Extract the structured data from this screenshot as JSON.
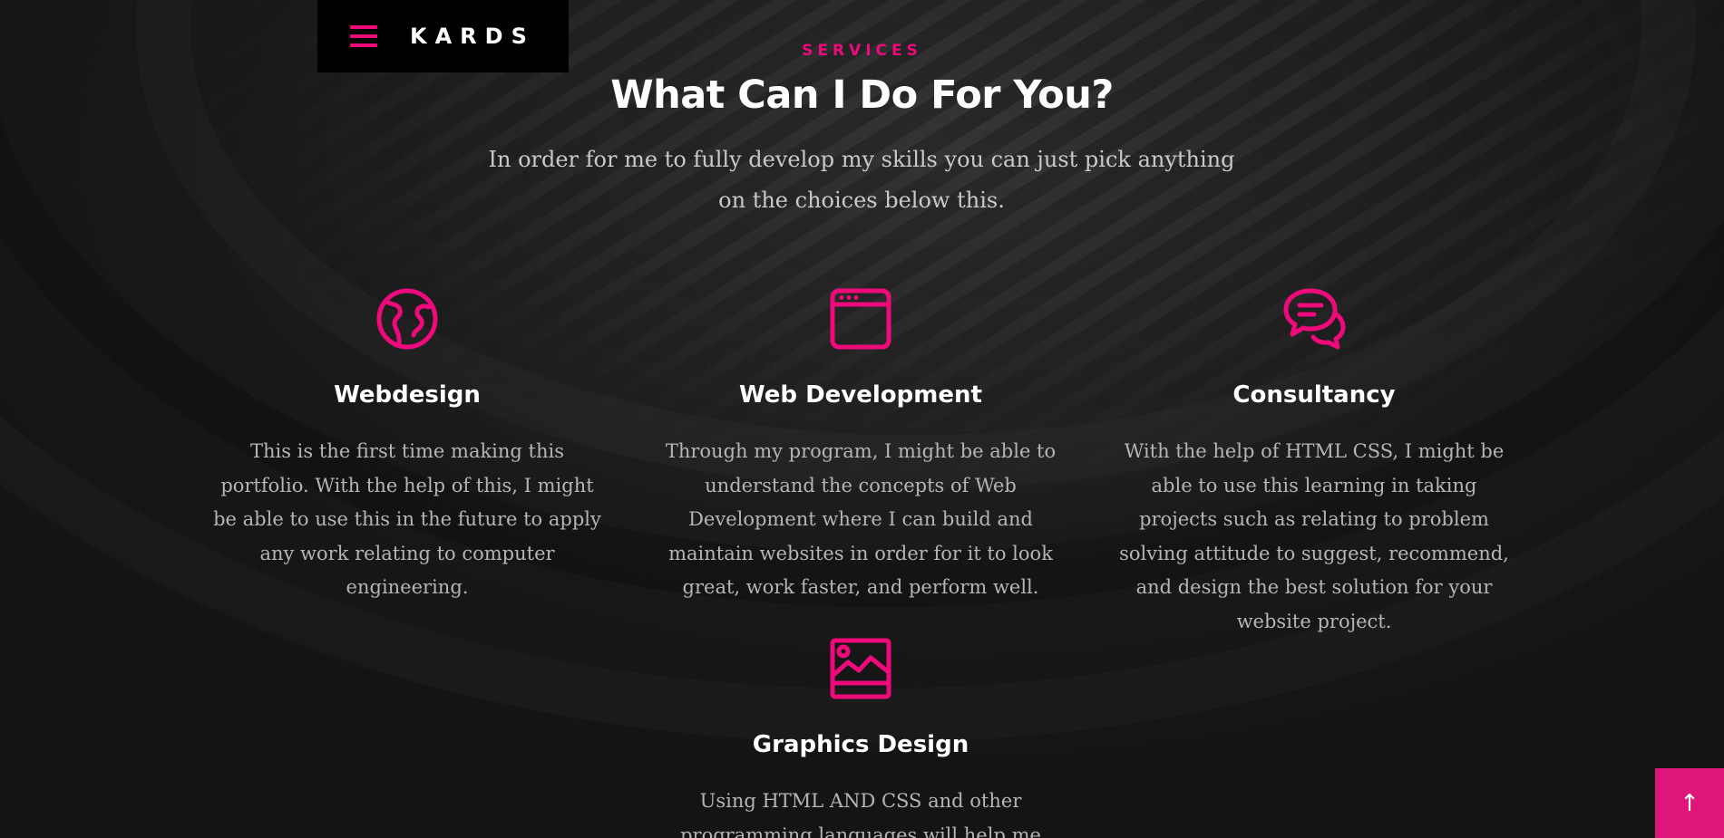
{
  "header": {
    "brand": "KARDS",
    "menu_icon": "hamburger-menu-icon"
  },
  "section": {
    "kicker": "SERVICES",
    "title": "What Can I Do For You?",
    "lead": "In order for me to fully develop my skills you can just pick anything on the choices below this."
  },
  "services": [
    {
      "icon": "globe-icon",
      "title": "Webdesign",
      "text": "This is the first time making this portfolio. With the help of this, I might be able to use this in the future to apply any work relating to computer engineering."
    },
    {
      "icon": "browser-window-icon",
      "title": "Web Development",
      "text": "Through my program, I might be able to understand the concepts of Web Development where I can build and maintain websites in order for it to look great, work faster, and perform well."
    },
    {
      "icon": "chat-bubbles-icon",
      "title": "Consultancy",
      "text": "With the help of HTML CSS, I might be able to use this learning in taking projects such as relating to problem solving attitude to suggest, recommend, and design the best solution for your website project."
    },
    {
      "icon": "image-icon",
      "title": "Graphics Design",
      "text": "Using HTML AND CSS and other programming languages will help me"
    }
  ],
  "back_to_top": {
    "icon": "arrow-up-icon",
    "glyph": "↑"
  },
  "colors": {
    "accent": "#ee0a7a",
    "background": "#161616",
    "title_text": "#ffffff",
    "body_text": "#b5b5b5"
  }
}
